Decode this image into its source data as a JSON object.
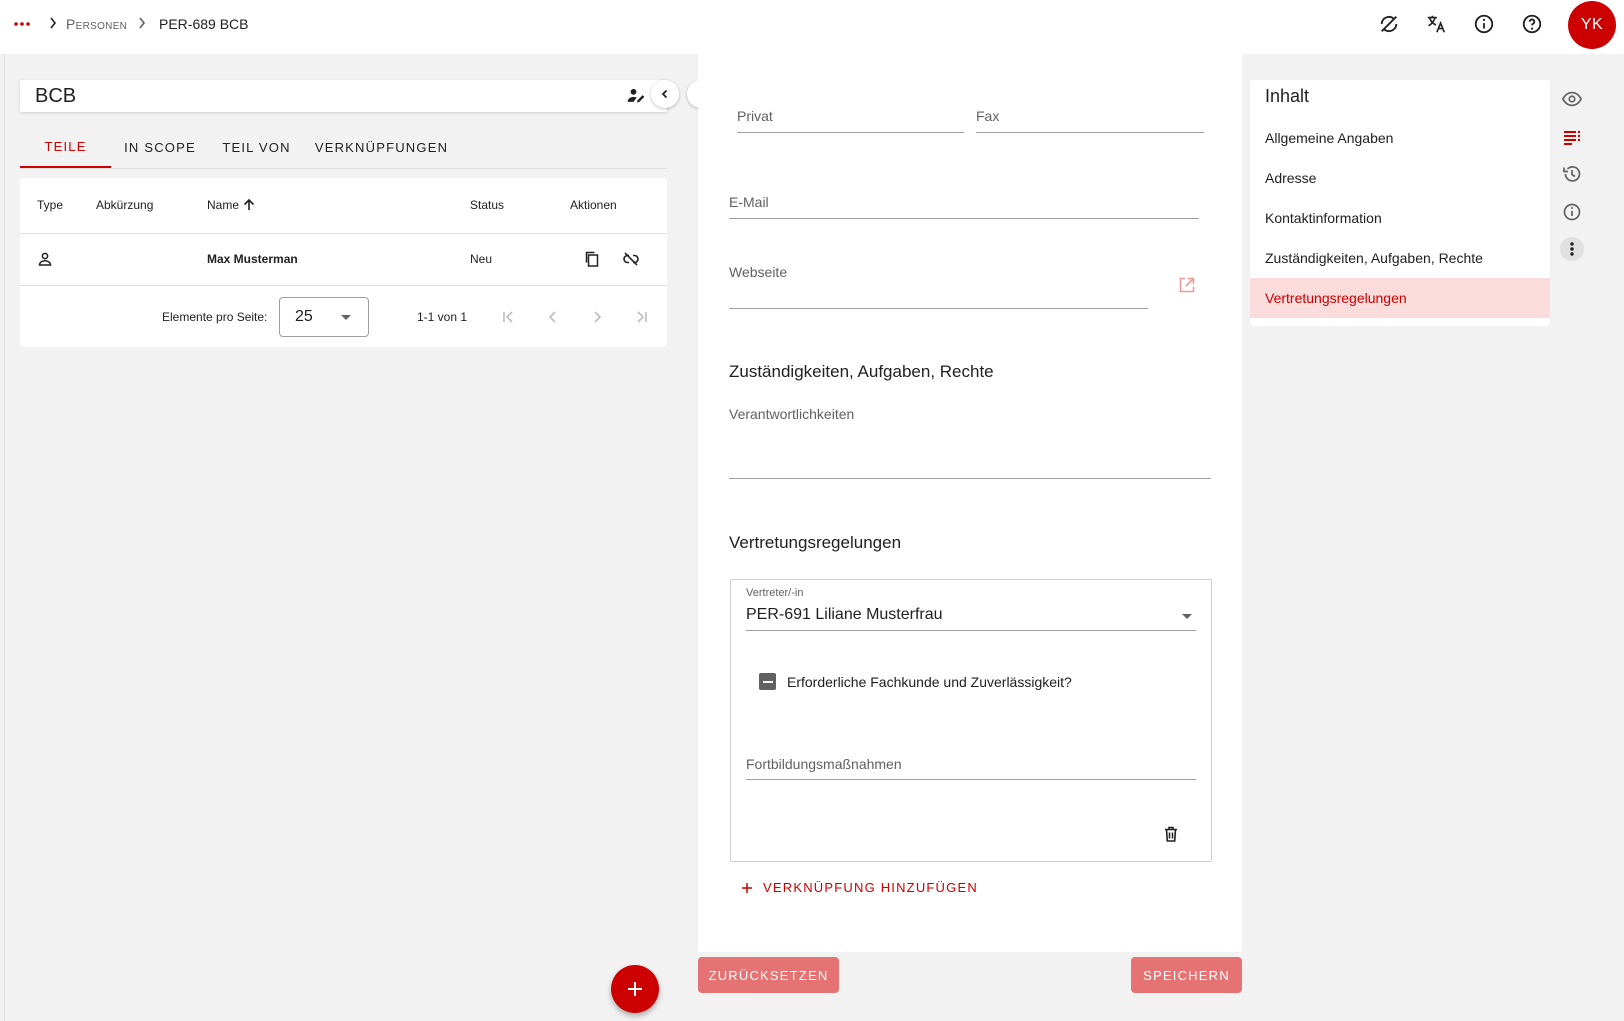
{
  "breadcrumb": {
    "menu_icon": "more-dots-icon",
    "items": [
      "Personen",
      "PER-689 BCB"
    ]
  },
  "header": {
    "icons": [
      "sync-disabled-icon",
      "translate-icon",
      "info-icon",
      "help-icon"
    ],
    "avatar_initials": "YK"
  },
  "left": {
    "title": "BCB",
    "tabs": [
      "TEILE",
      "IN SCOPE",
      "TEIL VON",
      "VERKNÜPFUNGEN"
    ],
    "active_tab": 0,
    "table": {
      "columns": [
        "Type",
        "Abkürzung",
        "Name",
        "Status",
        "Aktionen"
      ],
      "rows": [
        {
          "type_icon": "person-icon",
          "abbreviation": "",
          "name": "Max Musterman",
          "status": "Neu"
        }
      ]
    },
    "pagination": {
      "per_page_label": "Elemente pro Seite:",
      "per_page_value": "25",
      "range": "1-1 von 1"
    }
  },
  "form": {
    "privat_label": "Privat",
    "fax_label": "Fax",
    "email_label": "E-Mail",
    "website_label": "Webseite",
    "section_responsibilities": "Zuständigkeiten, Aufgaben, Rechte",
    "responsibilities_label": "Verantwortlichkeiten",
    "section_representation": "Vertretungsregelungen",
    "representative_label": "Vertreter/-in",
    "representative_value": "PER-691 Liliane Musterfrau",
    "checkbox_label": "Erforderliche Fachkunde und Zuverlässigkeit?",
    "training_label": "Fortbildungsmaßnahmen",
    "add_link_label": "VERKNÜPFUNG HINZUFÜGEN",
    "reset_label": "ZURÜCKSETZEN",
    "save_label": "SPEICHERN"
  },
  "toc": {
    "title": "Inhalt",
    "items": [
      "Allgemeine Angaben",
      "Adresse",
      "Kontaktinformation",
      "Zuständigkeiten, Aufgaben, Rechte",
      "Vertretungsregelungen"
    ],
    "active_index": 4
  },
  "colors": {
    "accent": "#cc0000",
    "accent_light": "#e57373",
    "toc_active_bg": "#fadcdc"
  }
}
